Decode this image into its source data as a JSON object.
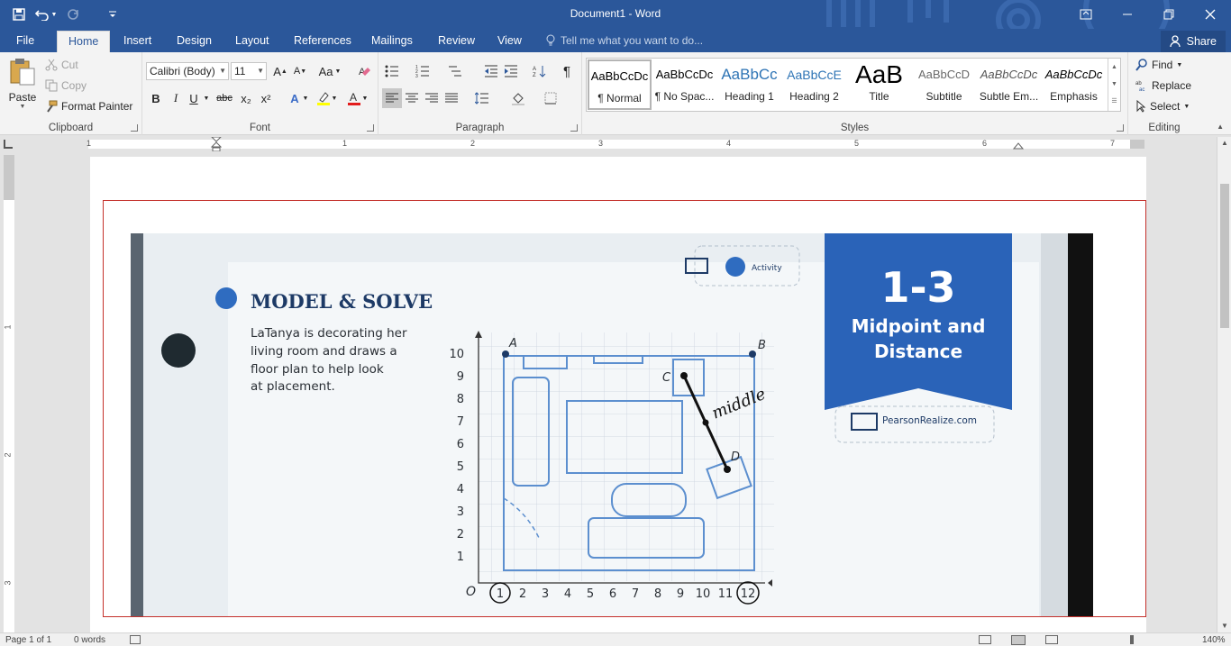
{
  "window": {
    "title": "Document1 - Word"
  },
  "qat": {
    "save": "save-icon",
    "undo": "undo-icon",
    "redo": "redo-icon",
    "customize": "customize-icon"
  },
  "tabs": [
    "File",
    "Home",
    "Insert",
    "Design",
    "Layout",
    "References",
    "Mailings",
    "Review",
    "View"
  ],
  "active_tab": "Home",
  "tell_me": "Tell me what you want to do...",
  "share": "Share",
  "clipboard": {
    "label": "Clipboard",
    "paste": "Paste",
    "cut": "Cut",
    "copy": "Copy",
    "format_painter": "Format Painter"
  },
  "font": {
    "label": "Font",
    "family": "Calibri (Body)",
    "size": "11",
    "bold": "B",
    "italic": "I",
    "underline": "U",
    "strike": "abc",
    "subscript": "x₂",
    "superscript": "x²",
    "case": "Aa"
  },
  "paragraph": {
    "label": "Paragraph"
  },
  "styles": {
    "label": "Styles",
    "items": [
      {
        "preview": "AaBbCcDc",
        "name": "¶ Normal"
      },
      {
        "preview": "AaBbCcDc",
        "name": "¶ No Spac..."
      },
      {
        "preview": "AaBbCc",
        "name": "Heading 1"
      },
      {
        "preview": "AaBbCcE",
        "name": "Heading 2"
      },
      {
        "preview": "AaB",
        "name": "Title"
      },
      {
        "preview": "AaBbCcD",
        "name": "Subtitle"
      },
      {
        "preview": "AaBbCcDc",
        "name": "Subtle Em..."
      },
      {
        "preview": "AaBbCcDc",
        "name": "Emphasis"
      }
    ]
  },
  "editing": {
    "label": "Editing",
    "find": "Find",
    "replace": "Replace",
    "select": "Select"
  },
  "ruler": {
    "numbers": [
      "1",
      "1",
      "2",
      "3",
      "4",
      "5",
      "6",
      "7"
    ]
  },
  "vruler": {
    "numbers": [
      "1",
      "2",
      "3"
    ]
  },
  "photo": {
    "heading": "MODEL & SOLVE",
    "body": [
      "LaTanya is decorating her",
      "living room and draws a",
      "floor plan to help look",
      "at placement."
    ],
    "activity": "Activity",
    "lesson": "1-3",
    "lesson_title_1": "Midpoint and",
    "lesson_title_2": "Distance",
    "site": "PearsonRealize.com",
    "handwritten": "middle",
    "point_a": "A",
    "point_b": "B",
    "point_c": "C",
    "point_d": "D",
    "origin": "O",
    "x_ticks": [
      "1",
      "2",
      "3",
      "4",
      "5",
      "6",
      "7",
      "8",
      "9",
      "10",
      "11",
      "12"
    ],
    "y_ticks": [
      "1",
      "2",
      "3",
      "4",
      "5",
      "6",
      "7",
      "8",
      "9",
      "10"
    ]
  },
  "status": {
    "page": "Page 1 of 1",
    "words": "0 words",
    "zoom": "140%"
  }
}
